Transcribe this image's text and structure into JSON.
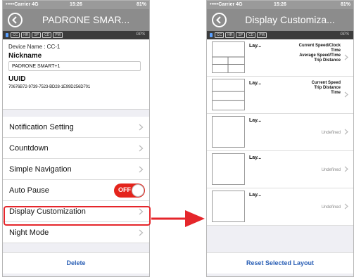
{
  "left_screen": {
    "status": {
      "carrier": "•••••Carrier",
      "network": "4G",
      "time": "15:26",
      "battery": "81%"
    },
    "nav_title": "PADRONE SMAR...",
    "sensor_chips": [
      "CC",
      "HR",
      "SP",
      "CD",
      "PW"
    ],
    "gps": "GPS",
    "device_name_line": "Device Name : CC-1",
    "nickname_label": "Nickname",
    "nickname_value": "PADRONE SMART+1",
    "uuid_label": "UUID",
    "uuid_value": "70676B72-9739-7523-BD28-1E99D256D701",
    "menu": [
      {
        "label": "Notification Setting"
      },
      {
        "label": "Countdown"
      },
      {
        "label": "Simple Navigation"
      },
      {
        "label": "Auto Pause"
      },
      {
        "label": "Display Customization"
      },
      {
        "label": "Night Mode"
      }
    ],
    "auto_pause_toggle": "OFF",
    "delete_label": "Delete"
  },
  "right_screen": {
    "status": {
      "carrier": "•••••Carrier",
      "network": "4G",
      "time": "15:26",
      "battery": "81%"
    },
    "nav_title": "Display Customiza...",
    "sensor_chips": [
      "CC",
      "HR",
      "SP",
      "CD",
      "PW"
    ],
    "gps": "GPS",
    "layouts": [
      {
        "name": "Lay...",
        "description": "Current Speed/Clock\nTime\nAverage Speed/Time\nTrip Distance"
      },
      {
        "name": "Lay...",
        "description": "Current Speed\nTrip Distance\nTime"
      },
      {
        "name": "Lay...",
        "description": "Undefined"
      },
      {
        "name": "Lay...",
        "description": "Undefined"
      },
      {
        "name": "Lay...",
        "description": "Undefined"
      }
    ],
    "reset_label": "Reset Selected Layout"
  },
  "colors": {
    "nav_gray": "#8c8c8c",
    "highlight_red": "#e5262b",
    "link_blue": "#2a5fb5",
    "toggle_red": "#e4241c"
  },
  "icons": [
    "back-arrow-icon",
    "chevron-right-icon",
    "bluetooth-icon",
    "red-arrow-icon"
  ]
}
